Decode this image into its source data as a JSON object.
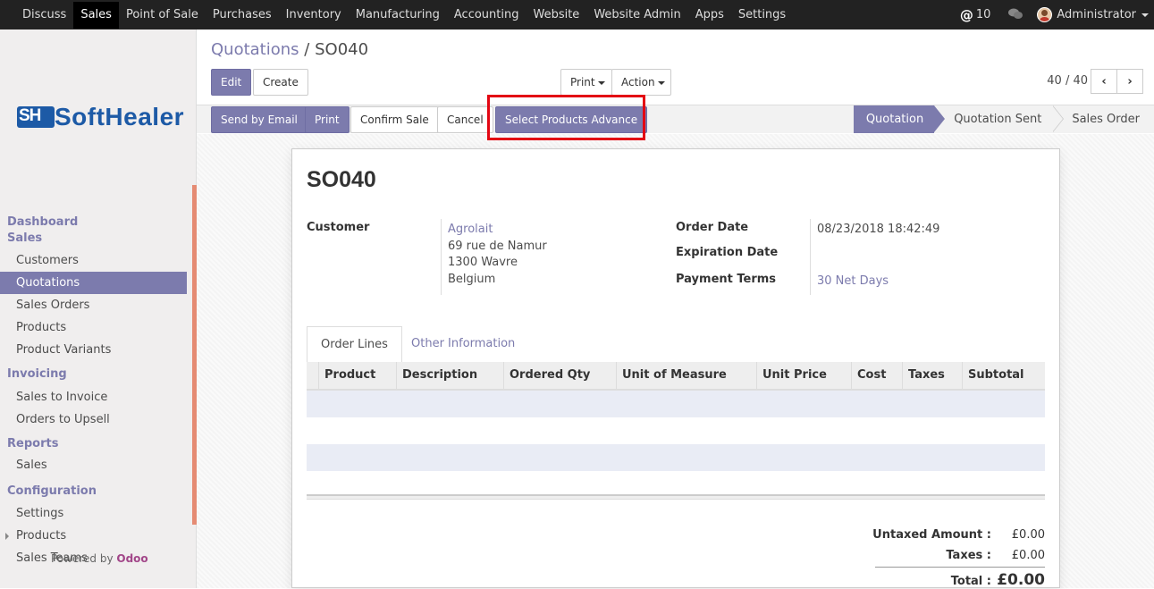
{
  "topbar": {
    "menu": [
      {
        "label": "Discuss",
        "active": false
      },
      {
        "label": "Sales",
        "active": true
      },
      {
        "label": "Point of Sale",
        "active": false
      },
      {
        "label": "Purchases",
        "active": false
      },
      {
        "label": "Inventory",
        "active": false
      },
      {
        "label": "Manufacturing",
        "active": false
      },
      {
        "label": "Accounting",
        "active": false
      },
      {
        "label": "Website",
        "active": false
      },
      {
        "label": "Website Admin",
        "active": false
      },
      {
        "label": "Apps",
        "active": false
      },
      {
        "label": "Settings",
        "active": false
      }
    ],
    "mentions_count": "10",
    "mentions_symbol": "@",
    "user_name": "Administrator"
  },
  "logo": {
    "mark": "SH",
    "text": "SoftHealer"
  },
  "sidebar": {
    "sections": [
      {
        "head": "Dashboard",
        "items": []
      },
      {
        "head": "Sales",
        "items": [
          {
            "label": "Customers",
            "active": false
          },
          {
            "label": "Quotations",
            "active": true
          },
          {
            "label": "Sales Orders",
            "active": false
          },
          {
            "label": "Products",
            "active": false
          },
          {
            "label": "Product Variants",
            "active": false
          }
        ]
      },
      {
        "head": "Invoicing",
        "items": [
          {
            "label": "Sales to Invoice",
            "active": false
          },
          {
            "label": "Orders to Upsell",
            "active": false
          }
        ]
      },
      {
        "head": "Reports",
        "items": [
          {
            "label": "Sales",
            "active": false
          }
        ]
      },
      {
        "head": "Configuration",
        "items": [
          {
            "label": "Settings",
            "active": false
          },
          {
            "label": "Products",
            "active": false,
            "expandable": true
          },
          {
            "label": "Sales Teams",
            "active": false
          }
        ]
      }
    ],
    "powered_by": "Powered by",
    "powered_brand": "Odoo"
  },
  "breadcrumb": {
    "parent": "Quotations",
    "separator": "/",
    "current": "SO040"
  },
  "buttons": {
    "edit": "Edit",
    "create": "Create",
    "print_menu": "Print",
    "action_menu": "Action",
    "send_email": "Send by Email",
    "print": "Print",
    "confirm": "Confirm Sale",
    "cancel": "Cancel",
    "select_products": "Select Products Advance"
  },
  "pager": {
    "value": "40 / 40",
    "prev": "‹",
    "next": "›"
  },
  "stages": [
    "Quotation",
    "Quotation Sent",
    "Sales Order"
  ],
  "form": {
    "title": "SO040",
    "customer_label": "Customer",
    "customer_name": "Agrolait",
    "customer_address": [
      "69 rue de Namur",
      "1300 Wavre",
      "Belgium"
    ],
    "order_date_label": "Order Date",
    "order_date": "08/23/2018 18:42:49",
    "expiration_label": "Expiration Date",
    "payment_terms_label": "Payment Terms",
    "payment_terms": "30 Net Days",
    "tabs": [
      "Order Lines",
      "Other Information"
    ],
    "columns": [
      "Product",
      "Description",
      "Ordered Qty",
      "Unit of Measure",
      "Unit Price",
      "Cost",
      "Taxes",
      "Subtotal"
    ],
    "totals": {
      "untaxed_label": "Untaxed Amount :",
      "untaxed": "£0.00",
      "taxes_label": "Taxes :",
      "taxes": "£0.00",
      "total_label": "Total :",
      "total": "£0.00"
    }
  },
  "colors": {
    "accent": "#7c7bad",
    "highlight": "#e30613",
    "logo": "#1d5aa6"
  }
}
